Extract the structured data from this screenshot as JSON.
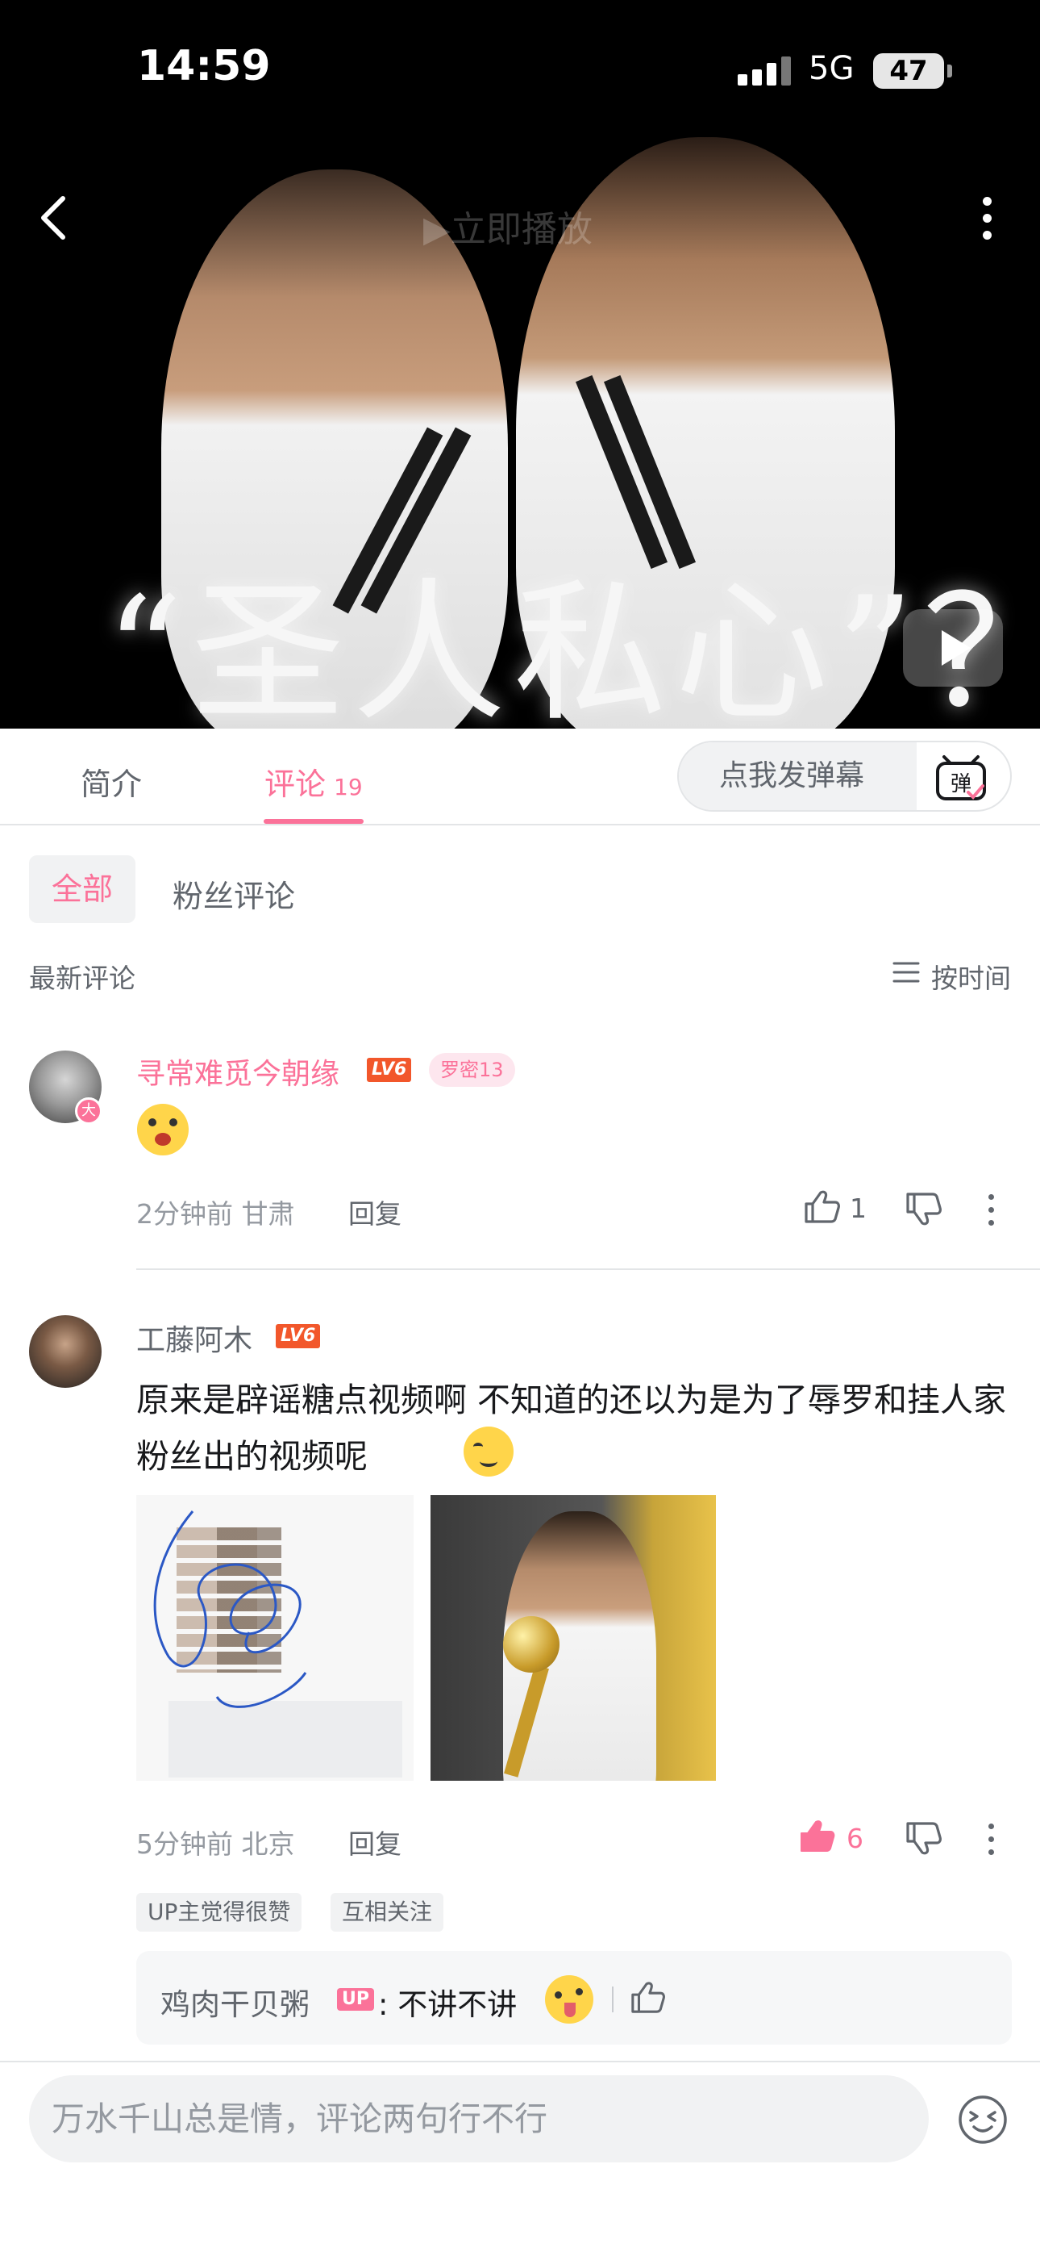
{
  "status": {
    "time": "14:59",
    "network": "5G",
    "battery": "47"
  },
  "video": {
    "play_now": "▶立即播放",
    "caption": "“圣人私心”？"
  },
  "tabs": {
    "intro": "简介",
    "comments": "评论",
    "comments_count": "19"
  },
  "danmaku": {
    "placeholder": "点我发弹幕",
    "icon_label": "弹"
  },
  "filters": {
    "all": "全部",
    "fans": "粉丝评论"
  },
  "list": {
    "heading": "最新评论",
    "sort_label": "按时间"
  },
  "comments": [
    {
      "username": "寻常难觅今朝缘",
      "level": "LV6",
      "avatar_badge": "大",
      "fan_badge": "罗密13",
      "time": "2分钟前 甘肃",
      "reply_label": "回复",
      "likes": "1"
    },
    {
      "username": "工藤阿木",
      "level": "LV6",
      "text": "原来是辟谣糖点视频啊 不知道的还以为是为了辱罗和挂人家粉丝出的视频呢",
      "time": "5分钟前 北京",
      "reply_label": "回复",
      "likes": "6",
      "tags": [
        "UP主觉得很赞",
        "互相关注"
      ],
      "sub_reply": {
        "user": "鸡肉干贝粥",
        "badge": "UP",
        "text": ": 不讲不讲"
      }
    }
  ],
  "input": {
    "placeholder": "万水千山总是情，评论两句行不行"
  },
  "colors": {
    "accent": "#fb7299",
    "level": "#f2572b",
    "text_secondary": "#61666d",
    "text_muted": "#9499a0"
  }
}
